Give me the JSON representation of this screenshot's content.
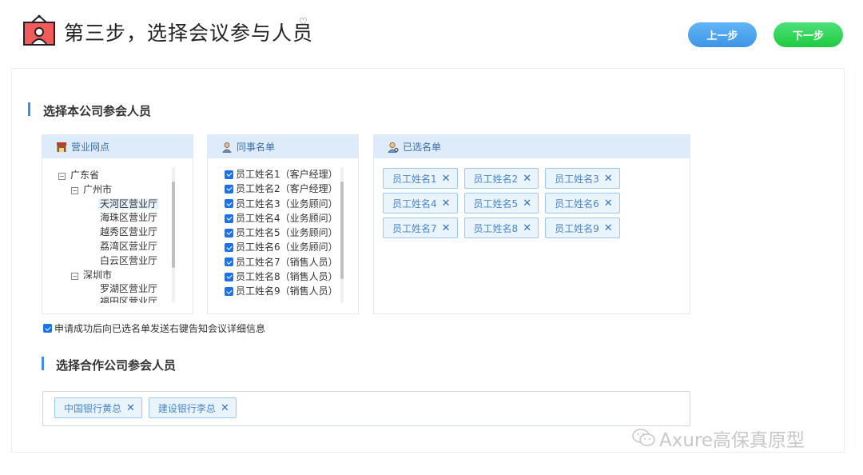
{
  "header": {
    "title": "第三步，选择会议参与人员",
    "prev_label": "上一步",
    "next_label": "下一步"
  },
  "section_company": {
    "title": "选择本公司参会人员"
  },
  "branches_panel": {
    "title": "营业网点",
    "tree": [
      {
        "label": "广东省",
        "toggle": "⊟",
        "level": 0
      },
      {
        "label": "广州市",
        "toggle": "⊟",
        "level": 1
      },
      {
        "label": "天河区营业厅",
        "level": 2,
        "selected": true
      },
      {
        "label": "海珠区营业厅",
        "level": 2
      },
      {
        "label": "越秀区营业厅",
        "level": 2
      },
      {
        "label": "荔湾区营业厅",
        "level": 2
      },
      {
        "label": "白云区营业厅",
        "level": 2
      },
      {
        "label": "深圳市",
        "toggle": "⊟",
        "level": 1
      },
      {
        "label": "罗湖区营业厅",
        "level": 2
      },
      {
        "label": "福田区营业厅",
        "level": 2
      }
    ]
  },
  "colleagues_panel": {
    "title": "同事名单",
    "items": [
      "员工姓名1（客户经理）",
      "员工姓名2（客户经理）",
      "员工姓名3（业务顾问）",
      "员工姓名4（业务顾问）",
      "员工姓名5（业务顾问）",
      "员工姓名6（业务顾问）",
      "员工姓名7（销售人员）",
      "员工姓名8（销售人员）",
      "员工姓名9（销售人员）"
    ]
  },
  "selected_panel": {
    "title": "已选名单",
    "tags": [
      "员工姓名1",
      "员工姓名2",
      "员工姓名3",
      "员工姓名4",
      "员工姓名5",
      "员工姓名6",
      "员工姓名7",
      "员工姓名8",
      "员工姓名9"
    ],
    "remove_glyph": "✕"
  },
  "notify_option": {
    "label": "申请成功后向已选名单发送右键告知会议详细信息",
    "checked": true
  },
  "section_partner": {
    "title": "选择合作公司参会人员",
    "tags": [
      "中国银行黄总",
      "建设银行李总"
    ]
  },
  "watermark": {
    "text": "Axure高保真原型"
  },
  "colors": {
    "accent": "#3d8cf0",
    "prev_button": "#4aa3ee",
    "next_button": "#22cc44",
    "panel_header": "#deebfb",
    "tag_border": "#9cc8ef"
  },
  "icons": {
    "header": "presentation-board-icon",
    "branches": "store-icon",
    "colleagues": "person-icon",
    "selected": "user-search-icon",
    "watermark": "wechat-icon"
  }
}
